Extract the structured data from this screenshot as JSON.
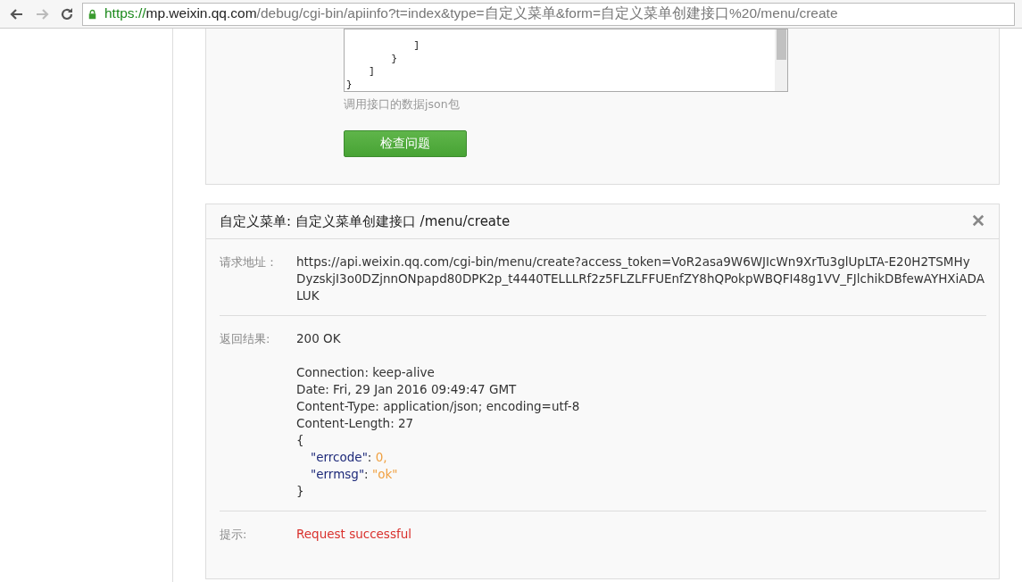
{
  "browser": {
    "url": {
      "scheme": "https://",
      "host": "mp.weixin.qq.com",
      "path": "/debug/cgi-bin/apiinfo?t=index&type=自定义菜单&form=自定义菜单创建接口%20/menu/create"
    }
  },
  "request_panel": {
    "textarea_lines": [
      "            ]",
      "        }",
      "    ]",
      "}"
    ],
    "hint": "调用接口的数据json包",
    "check_button": "检查问题"
  },
  "result_panel": {
    "title": "自定义菜单: 自定义菜单创建接口 /menu/create",
    "rows": [
      {
        "kind": "text",
        "label": "请求地址：",
        "lines": [
          "https://api.weixin.qq.com/cgi-bin/menu/create?access_token=VoR2asa9W6WJIcWn9XrTu3glUpLTA-E20H2TSMHy",
          "DyzskjI3o0DZjnnONpapd80DPK2p_t4440TELLLRf2z5FLZLFFUEnfZY8hQPokpWBQFI48g1VV_FJlchikDBfewAYHXiADA",
          "LUK"
        ]
      },
      {
        "kind": "response",
        "label": "返回结果:",
        "status": "200 OK",
        "headers": [
          "Connection: keep-alive",
          "Date: Fri, 29 Jan 2016 09:49:47 GMT",
          "Content-Type: application/json; encoding=utf-8",
          "Content-Length: 27"
        ],
        "open": "{",
        "fields": [
          {
            "key": "\"errcode\"",
            "sep": ":",
            "value": "0,"
          },
          {
            "key": "\"errmsg\"",
            "sep": ":",
            "value": "\"ok\""
          }
        ],
        "close": "}"
      },
      {
        "kind": "notice",
        "label": "提示:",
        "lines": [
          "Request successful"
        ]
      }
    ]
  }
}
